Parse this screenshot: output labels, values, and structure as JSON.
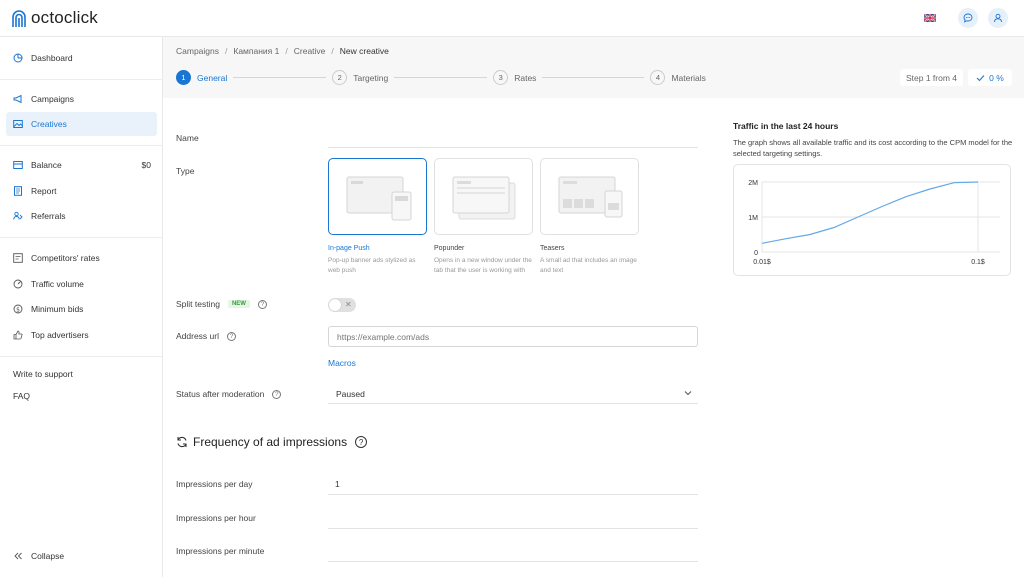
{
  "app": {
    "logo_text": "octoclick"
  },
  "colors": {
    "accent": "#1976d2",
    "active_bg": "#e9f2fb",
    "header_bg": "#f7f7f7",
    "chart_line": "#64a8e6"
  },
  "sidebar": {
    "items": [
      {
        "label": "Dashboard",
        "icon": "dashboard-icon"
      },
      {
        "label": "Campaigns",
        "icon": "megaphone-icon"
      },
      {
        "label": "Creatives",
        "icon": "image-icon"
      },
      {
        "label": "Balance",
        "icon": "wallet-icon",
        "value": "$0"
      },
      {
        "label": "Report",
        "icon": "report-icon"
      },
      {
        "label": "Referrals",
        "icon": "referrals-icon"
      },
      {
        "label": "Competitors' rates",
        "icon": "rates-icon"
      },
      {
        "label": "Traffic volume",
        "icon": "traffic-icon"
      },
      {
        "label": "Minimum bids",
        "icon": "dollar-icon"
      },
      {
        "label": "Top advertisers",
        "icon": "thumb-icon"
      }
    ],
    "write_support": "Write to support",
    "faq": "FAQ",
    "collapse": "Collapse"
  },
  "breadcrumbs": [
    "Campaigns",
    "Кампания 1",
    "Creative",
    "New creative"
  ],
  "steps": [
    {
      "num": "1",
      "label": "General"
    },
    {
      "num": "2",
      "label": "Targeting"
    },
    {
      "num": "3",
      "label": "Rates"
    },
    {
      "num": "4",
      "label": "Materials"
    }
  ],
  "step_counter": "Step 1 from 4",
  "progress": "0 %",
  "form": {
    "name_label": "Name",
    "name_value": "",
    "type_label": "Type",
    "types": [
      {
        "name": "In-page Push",
        "desc": "Pop-up banner ads stylized as web push"
      },
      {
        "name": "Popunder",
        "desc": "Opens in a new window under the tab that the user is working with"
      },
      {
        "name": "Teasers",
        "desc": "A small ad that includes an image and text"
      }
    ],
    "split_testing_label": "Split testing",
    "split_testing_badge": "NEW",
    "address_label": "Address url",
    "address_placeholder": "https://example.com/ads",
    "macros": "Macros",
    "status_label": "Status after moderation",
    "status_value": "Paused"
  },
  "frequency": {
    "title": "Frequency of ad impressions",
    "per_day_label": "Impressions per day",
    "per_day_value": "1",
    "per_hour_label": "Impressions per hour",
    "per_hour_value": "",
    "per_minute_label": "Impressions per minute",
    "per_minute_value": ""
  },
  "traffic_panel": {
    "title": "Traffic in the last 24 hours",
    "description": "The graph shows all available traffic and its cost according to the CPM model for the selected targeting settings."
  },
  "chart_data": {
    "type": "line",
    "title": "Traffic in the last 24 hours",
    "x": [
      0.01,
      0.02,
      0.03,
      0.04,
      0.05,
      0.06,
      0.07,
      0.08,
      0.09,
      0.1
    ],
    "series": [
      {
        "values": [
          0.25,
          0.38,
          0.5,
          0.7,
          1.0,
          1.3,
          1.58,
          1.8,
          1.98,
          2.0
        ]
      }
    ],
    "xtick_labels": [
      "0.01$",
      "0.1$"
    ],
    "ytick_labels": [
      "0",
      "1M",
      "2M"
    ],
    "ylim": [
      0,
      2
    ],
    "grid": true
  }
}
